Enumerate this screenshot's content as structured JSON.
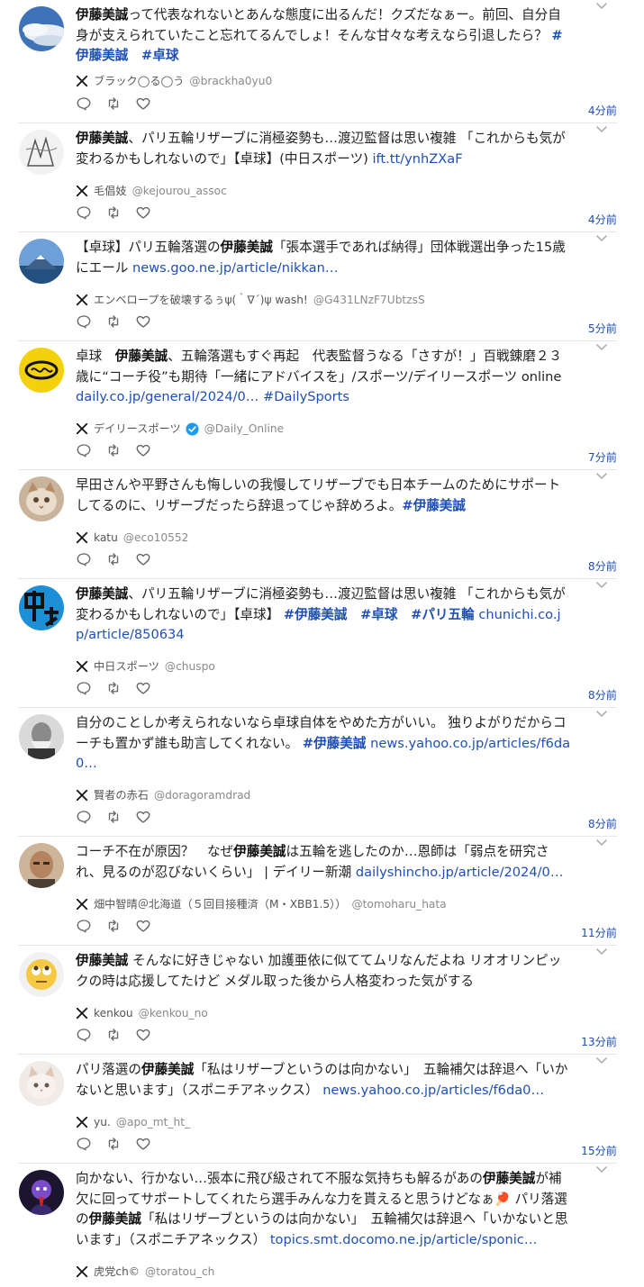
{
  "feed": {
    "posts": [
      {
        "avatar": "clouds-avatar",
        "segments": [
          {
            "t": "伊藤美誠",
            "k": "kw"
          },
          {
            "t": "って代表なれないとあんな態度に出るんだ！クズだなぁー。前回、自分自身が支えられていたこと忘れてるんでしょ！そんな甘々な考えなら引退したら？ ",
            "k": "text"
          },
          {
            "t": "#伊藤美誠",
            "k": "tag"
          },
          {
            "t": "　",
            "k": "text"
          },
          {
            "t": "#卓球",
            "k": "tag"
          }
        ],
        "source": {
          "name": "ブラック◯る◯う",
          "handle": "@brackha0yu0",
          "verified": false
        },
        "time": "4分前"
      },
      {
        "avatar": "sketch-avatar",
        "segments": [
          {
            "t": "伊藤美誠",
            "k": "kw"
          },
          {
            "t": "、パリ五輪リザーブに消極姿勢も…渡辺監督は思い複雑 「これからも気が変わるかもしれないので」【卓球】(中日スポーツ) ",
            "k": "text"
          },
          {
            "t": "ift.tt/ynhZXaF",
            "k": "lnk"
          }
        ],
        "source": {
          "name": "毛倡妓",
          "handle": "@kejourou_assoc",
          "verified": false
        },
        "time": "4分前"
      },
      {
        "avatar": "mountain-avatar",
        "segments": [
          {
            "t": "【卓球】パリ五輪落選の",
            "k": "text"
          },
          {
            "t": "伊藤美誠",
            "k": "kw"
          },
          {
            "t": "「張本選手であれば納得」団体戦選出争った15歳にエール ",
            "k": "text"
          },
          {
            "t": "news.goo.ne.jp/article/nikkan…",
            "k": "lnk"
          }
        ],
        "source": {
          "name": "エンベロープを破壊するぅψ(｀∇´)ψ wash!",
          "handle": "@G431LNzF7UbtzsS",
          "verified": false
        },
        "time": "5分前"
      },
      {
        "avatar": "daily-logo-avatar",
        "segments": [
          {
            "t": "卓球　",
            "k": "text"
          },
          {
            "t": "伊藤美誠",
            "k": "kw"
          },
          {
            "t": "、五輪落選もすぐ再起　代表監督うなる「さすが！」百戦錬磨２３歳に“コーチ役”も期待「一緒にアドバイスを」/スポーツ/デイリースポーツ online ",
            "k": "text"
          },
          {
            "t": "daily.co.jp/general/2024/0…",
            "k": "lnk"
          },
          {
            "t": " ",
            "k": "text"
          },
          {
            "t": "#DailySports",
            "k": "lnk"
          }
        ],
        "source": {
          "name": "デイリースポーツ",
          "handle": "@Daily_Online",
          "verified": true
        },
        "time": "7分前"
      },
      {
        "avatar": "cat-avatar",
        "segments": [
          {
            "t": "早田さんや平野さんも悔しいの我慢してリザーブでも日本チームのためにサポートしてるのに、リザーブだったら辞退ってじゃ辞めろよ。",
            "k": "text"
          },
          {
            "t": "#伊藤美誠",
            "k": "tag"
          }
        ],
        "source": {
          "name": "katu",
          "handle": "@eco10552",
          "verified": false
        },
        "time": "8分前"
      },
      {
        "avatar": "chuspo-logo-avatar",
        "segments": [
          {
            "t": "伊藤美誠",
            "k": "kw"
          },
          {
            "t": "、パリ五輪リザーブに消極姿勢も…渡辺監督は思い複雑 「これからも気が変わるかもしれないので」【卓球】 ",
            "k": "text"
          },
          {
            "t": "#伊藤美誠",
            "k": "tag"
          },
          {
            "t": "　",
            "k": "text"
          },
          {
            "t": "#卓球",
            "k": "tag"
          },
          {
            "t": "　",
            "k": "text"
          },
          {
            "t": "#パリ五輪",
            "k": "tag"
          },
          {
            "t": " chunichi.co.jp/article/850634",
            "k": "lnk"
          }
        ],
        "source": {
          "name": "中日スポーツ",
          "handle": "@chuspo",
          "verified": false
        },
        "time": "8分前"
      },
      {
        "avatar": "old-man-avatar",
        "segments": [
          {
            "t": "自分のことしか考えられないなら卓球自体をやめた方がいい。 独りよがりだからコーチも置かず誰も助言してくれない。 ",
            "k": "text"
          },
          {
            "t": "#伊藤美誠",
            "k": "tag"
          },
          {
            "t": " news.yahoo.co.jp/articles/f6da0…",
            "k": "lnk"
          }
        ],
        "source": {
          "name": "賢者の赤石",
          "handle": "@doragoramdrad",
          "verified": false
        },
        "time": "8分前"
      },
      {
        "avatar": "man-photo-avatar",
        "segments": [
          {
            "t": "コーチ不在が原因？　なぜ",
            "k": "text"
          },
          {
            "t": "伊藤美誠",
            "k": "kw"
          },
          {
            "t": "は五輪を逃したのか…恩師は「弱点を研究され、見るのが忍びないくらい」 | デイリー新潮 ",
            "k": "text"
          },
          {
            "t": "dailyshincho.jp/article/2024/0…",
            "k": "lnk"
          }
        ],
        "source": {
          "name": "畑中智晴＠北海道（５回目接種済（M・XBB1.5））",
          "handle": "@tomoharu_hata",
          "verified": false
        },
        "time": "11分前"
      },
      {
        "avatar": "eye-roll-emoji-avatar",
        "segments": [
          {
            "t": "伊藤美誠",
            "k": "kw"
          },
          {
            "t": " そんなに好きじゃない 加護亜依に似ててムリなんだよね リオオリンピックの時は応援してたけど メダル取った後から人格変わった気がする",
            "k": "text"
          }
        ],
        "source": {
          "name": "kenkou",
          "handle": "@kenkou_no",
          "verified": false
        },
        "time": "13分前"
      },
      {
        "avatar": "kitten-avatar",
        "segments": [
          {
            "t": "パリ落選の",
            "k": "text"
          },
          {
            "t": "伊藤美誠",
            "k": "kw"
          },
          {
            "t": "「私はリザーブというのは向かない」　五輪補欠は辞退へ「いかないと思います」（スポニチアネックス） ",
            "k": "text"
          },
          {
            "t": "news.yahoo.co.jp/articles/f6da0…",
            "k": "lnk"
          }
        ],
        "source": {
          "name": "yu.",
          "handle": "@apo_mt_ht_",
          "verified": false
        },
        "time": "15分前"
      },
      {
        "avatar": "purple-character-avatar",
        "segments": [
          {
            "t": "向かない、行かない…張本に飛び級されて不服な気持ちも解るがあの",
            "k": "text"
          },
          {
            "t": "伊藤美誠",
            "k": "kw"
          },
          {
            "t": "が補欠に回ってサポートしてくれたら選手みんな力を貰えると思うけどなぁ🏓 パリ落選の",
            "k": "text"
          },
          {
            "t": "伊藤美誠",
            "k": "kw"
          },
          {
            "t": "「私はリザーブというのは向かない」　五輪補欠は辞退へ「いかないと思います」（スポニチアネックス） ",
            "k": "text"
          },
          {
            "t": "topics.smt.docomo.ne.jp/article/sponic…",
            "k": "lnk"
          }
        ],
        "source": {
          "name": "虎党ch©",
          "handle": "@toratou_ch",
          "verified": false
        },
        "time": ""
      }
    ]
  }
}
